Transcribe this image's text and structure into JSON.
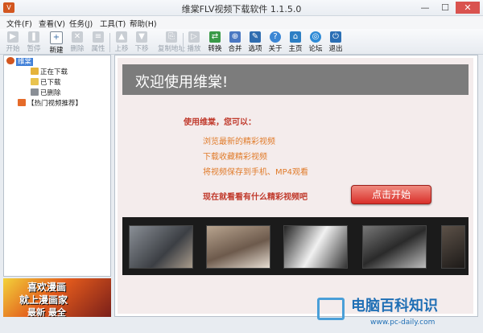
{
  "window": {
    "title": "维棠FLV视频下载软件 1.1.5.0",
    "app_icon": "V",
    "min_glyph": "—",
    "max_glyph": "☐",
    "close_glyph": "✕"
  },
  "menu": [
    "文件(F)",
    "查看(V)",
    "任务(J)",
    "工具(T)",
    "帮助(H)"
  ],
  "toolbar": {
    "start": "开始",
    "pause": "暂停",
    "new": "新建",
    "delete": "删除",
    "properties": "属性",
    "move_up": "上移",
    "move_down": "下移",
    "copy_address": "复制地址",
    "play": "播放",
    "convert": "转换",
    "merge": "合并",
    "options": "选项",
    "about": "关于",
    "home": "主页",
    "forum": "论坛",
    "exit": "退出"
  },
  "tree": {
    "root": "维棠",
    "downloading": "正在下载",
    "downloaded": "已下载",
    "deleted": "已删除",
    "recommend": "【热门视频推荐】"
  },
  "ad": {
    "line1": "喜欢漫画",
    "line2": "就上漫画家",
    "line3": "最新 最全"
  },
  "welcome": {
    "title": "欢迎使用维棠!",
    "intro": "使用维棠，您可以：",
    "features": [
      "浏览最新的精彩视频",
      "下载收藏精彩视频",
      "将视频保存到手机、MP4观看"
    ],
    "cta": "现在就看看有什么精彩视频吧",
    "start_button": "点击开始"
  },
  "watermark": {
    "text": "电脑百科知识",
    "url": "www.pc-daily.com"
  },
  "colors": {
    "accent_red": "#c0392b",
    "feature_orange": "#e07b2a",
    "selection_blue": "#3f7fd8"
  }
}
